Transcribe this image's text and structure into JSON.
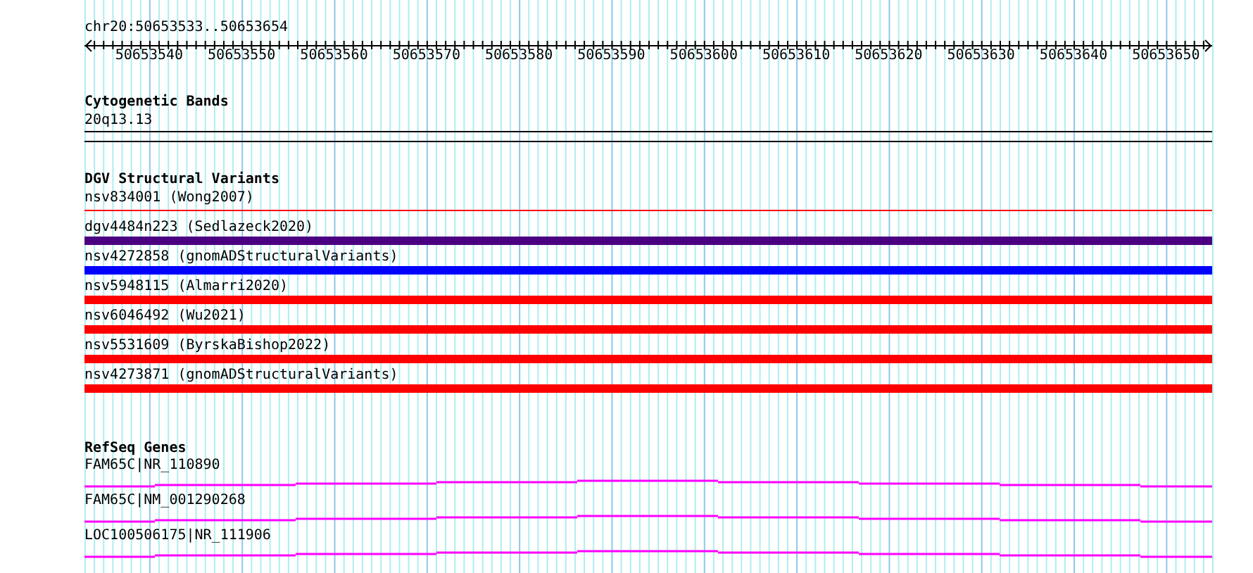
{
  "position": "chr20:50653533..50653654",
  "ruler": {
    "tick_labels": [
      "50653540",
      "50653550",
      "50653560",
      "50653570",
      "50653580",
      "50653590",
      "50653600",
      "50653610",
      "50653620",
      "50653630",
      "50653640",
      "50653650"
    ]
  },
  "cytogenetic_bands": {
    "title": "Cytogenetic Bands",
    "bands": [
      {
        "label": "20q13.13"
      }
    ]
  },
  "dgv_structural_variants": {
    "title": "DGV Structural Variants",
    "variants": [
      {
        "label": "nsv834001 (Wong2007)",
        "kind": "line",
        "color": "#ff0000"
      },
      {
        "label": "dgv4484n223 (Sedlazeck2020)",
        "kind": "bar",
        "color": "#4b0082"
      },
      {
        "label": "nsv4272858 (gnomADStructuralVariants)",
        "kind": "bar",
        "color": "#0000ff"
      },
      {
        "label": "nsv5948115 (Almarri2020)",
        "kind": "bar",
        "color": "#ff0000"
      },
      {
        "label": "nsv6046492 (Wu2021)",
        "kind": "bar",
        "color": "#ff0000"
      },
      {
        "label": "nsv5531609 (ByrskaBishop2022)",
        "kind": "bar",
        "color": "#ff0000"
      },
      {
        "label": "nsv4273871 (gnomADStructuralVariants)",
        "kind": "bar",
        "color": "#ff0000"
      }
    ]
  },
  "refseq_genes": {
    "title": "RefSeq Genes",
    "transcripts": [
      {
        "label": "FAM65C|NR_110890"
      },
      {
        "label": "FAM65C|NM_001290268"
      },
      {
        "label": "LOC100506175|NR_111906"
      }
    ]
  }
}
